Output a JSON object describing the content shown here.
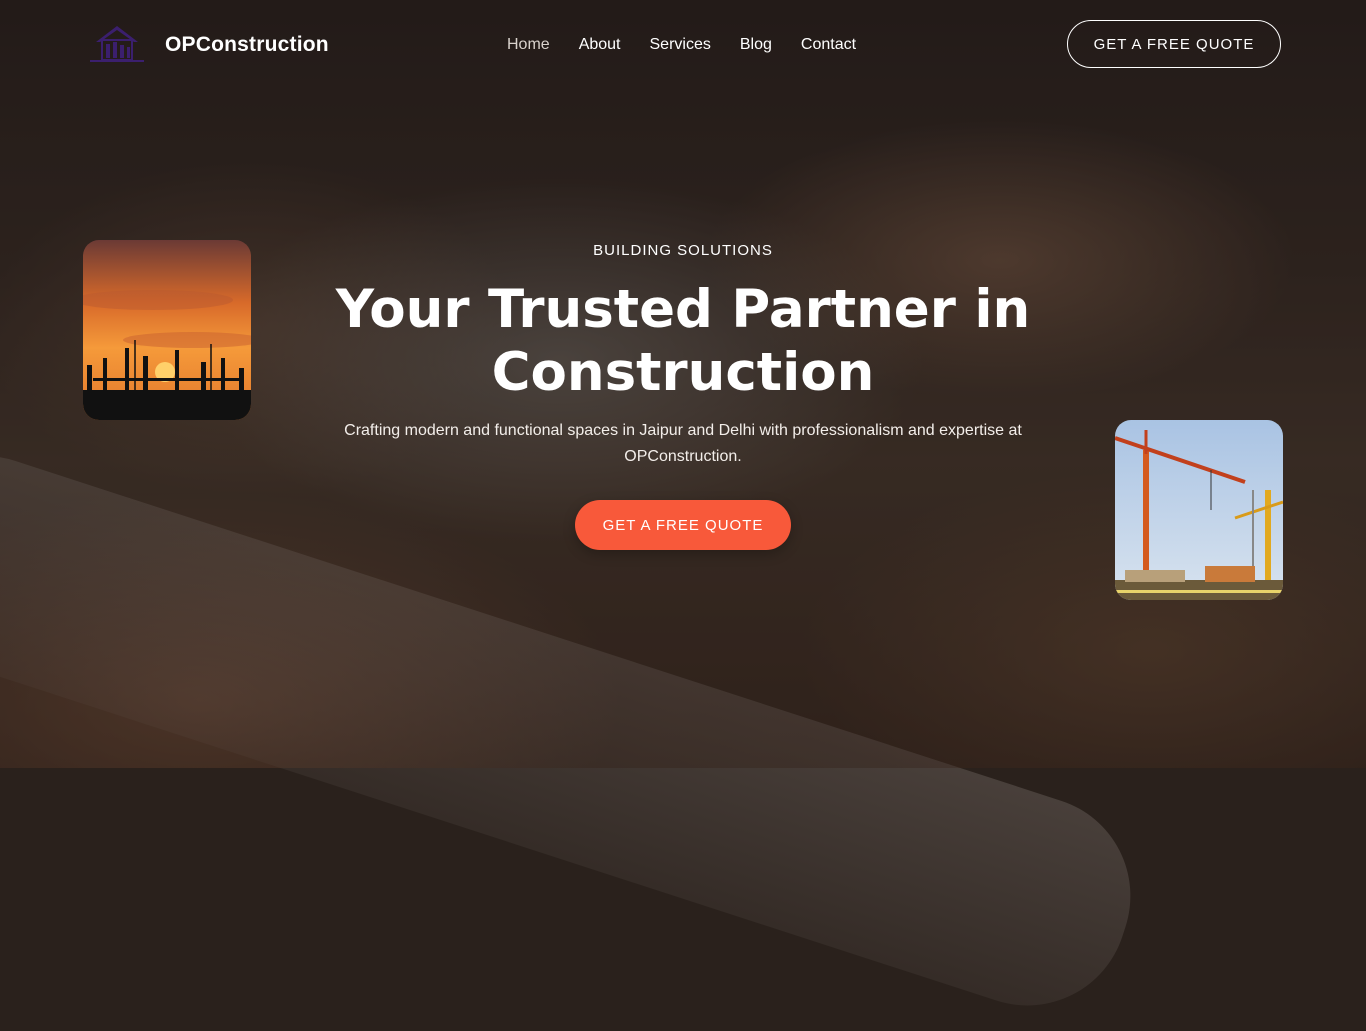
{
  "header": {
    "brand": "OPConstruction",
    "logo_icon": "house-logo-icon",
    "nav": [
      {
        "label": "Home",
        "active": true
      },
      {
        "label": "About",
        "active": false
      },
      {
        "label": "Services",
        "active": false
      },
      {
        "label": "Blog",
        "active": false
      },
      {
        "label": "Contact",
        "active": false
      }
    ],
    "cta_label": "GET A FREE QUOTE"
  },
  "hero": {
    "eyebrow": "BUILDING SOLUTIONS",
    "title": "Your Trusted Partner in Construction",
    "subtitle": "Crafting modern and functional spaces in Jaipur and Delhi with professionalism and expertise at OPConstruction.",
    "cta_label": "GET A FREE QUOTE"
  },
  "images": {
    "left": "sunset-construction-site-image",
    "right": "tower-crane-construction-image"
  },
  "colors": {
    "accent": "#f8593a",
    "text": "#ffffff",
    "logo": "#3b1f6e"
  }
}
